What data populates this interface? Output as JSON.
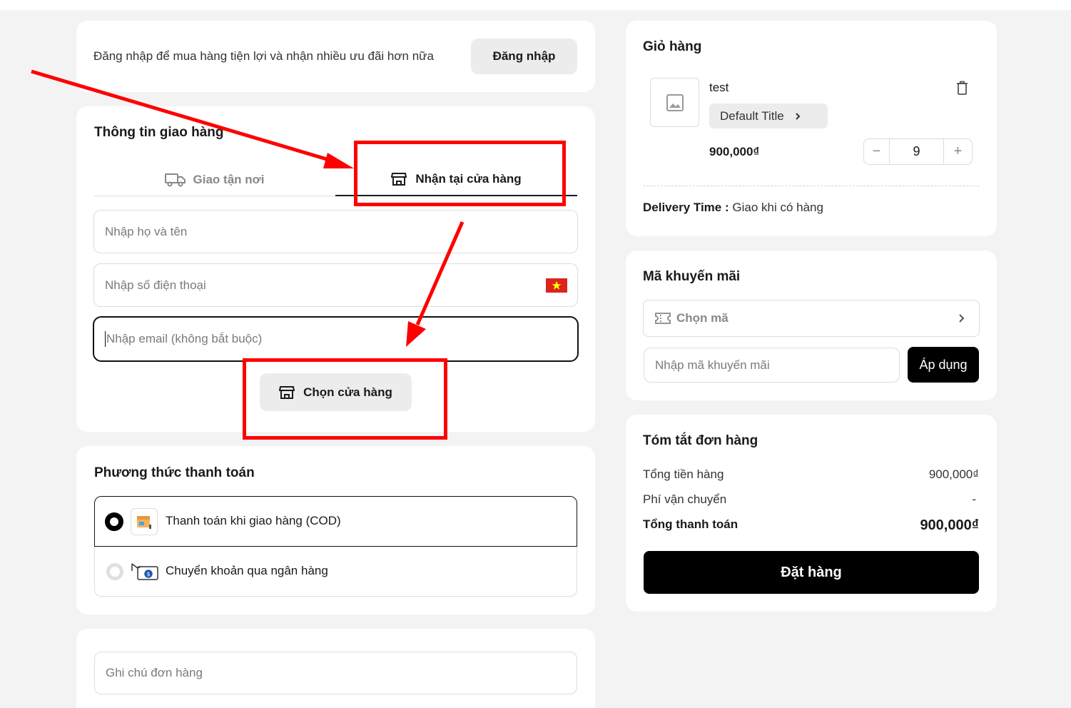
{
  "login": {
    "message": "Đăng nhập để mua hàng tiện lợi và nhận nhiều ưu đãi hơn nữa",
    "button_label": "Đăng nhập"
  },
  "shipping": {
    "title": "Thông tin giao hàng",
    "tabs": [
      {
        "label": "Giao tận nơi",
        "icon": "truck-icon",
        "active": false
      },
      {
        "label": "Nhận tại cửa hàng",
        "icon": "store-icon",
        "active": true
      }
    ],
    "name_placeholder": "Nhập họ và tên",
    "phone_placeholder": "Nhập số điện thoại",
    "email_placeholder": "Nhập email (không bắt buộc)",
    "choose_store_label": "Chọn cửa hàng"
  },
  "payment": {
    "title": "Phương thức thanh toán",
    "options": [
      {
        "label": "Thanh toán khi giao hàng (COD)",
        "selected": true,
        "icon": "cod-box-icon"
      },
      {
        "label": "Chuyển khoản qua ngân hàng",
        "selected": false,
        "icon": "bank-transfer-icon"
      }
    ]
  },
  "note": {
    "placeholder": "Ghi chú đơn hàng"
  },
  "cart": {
    "title": "Giỏ hàng",
    "item": {
      "name": "test",
      "variant": "Default Title",
      "price": "900,000₫",
      "quantity": "9"
    },
    "delivery_label": "Delivery Time :",
    "delivery_value": "Giao khi có hàng"
  },
  "promo": {
    "title": "Mã khuyến mãi",
    "choose_label": "Chọn mã",
    "input_placeholder": "Nhập mã khuyến mãi",
    "apply_label": "Áp dụng"
  },
  "summary": {
    "title": "Tóm tắt đơn hàng",
    "subtotal_label": "Tổng tiền hàng",
    "subtotal_value": "900,000₫",
    "shipping_label": "Phí vận chuyển",
    "shipping_value": "-",
    "total_label": "Tổng thanh toán",
    "total_value": "900,000₫",
    "order_button": "Đặt hàng"
  },
  "colors": {
    "annotation_red": "#ff0000",
    "primary_black": "#000000",
    "background": "#f3f3f3",
    "flag_red": "#da251d",
    "flag_star": "#ffff00"
  }
}
